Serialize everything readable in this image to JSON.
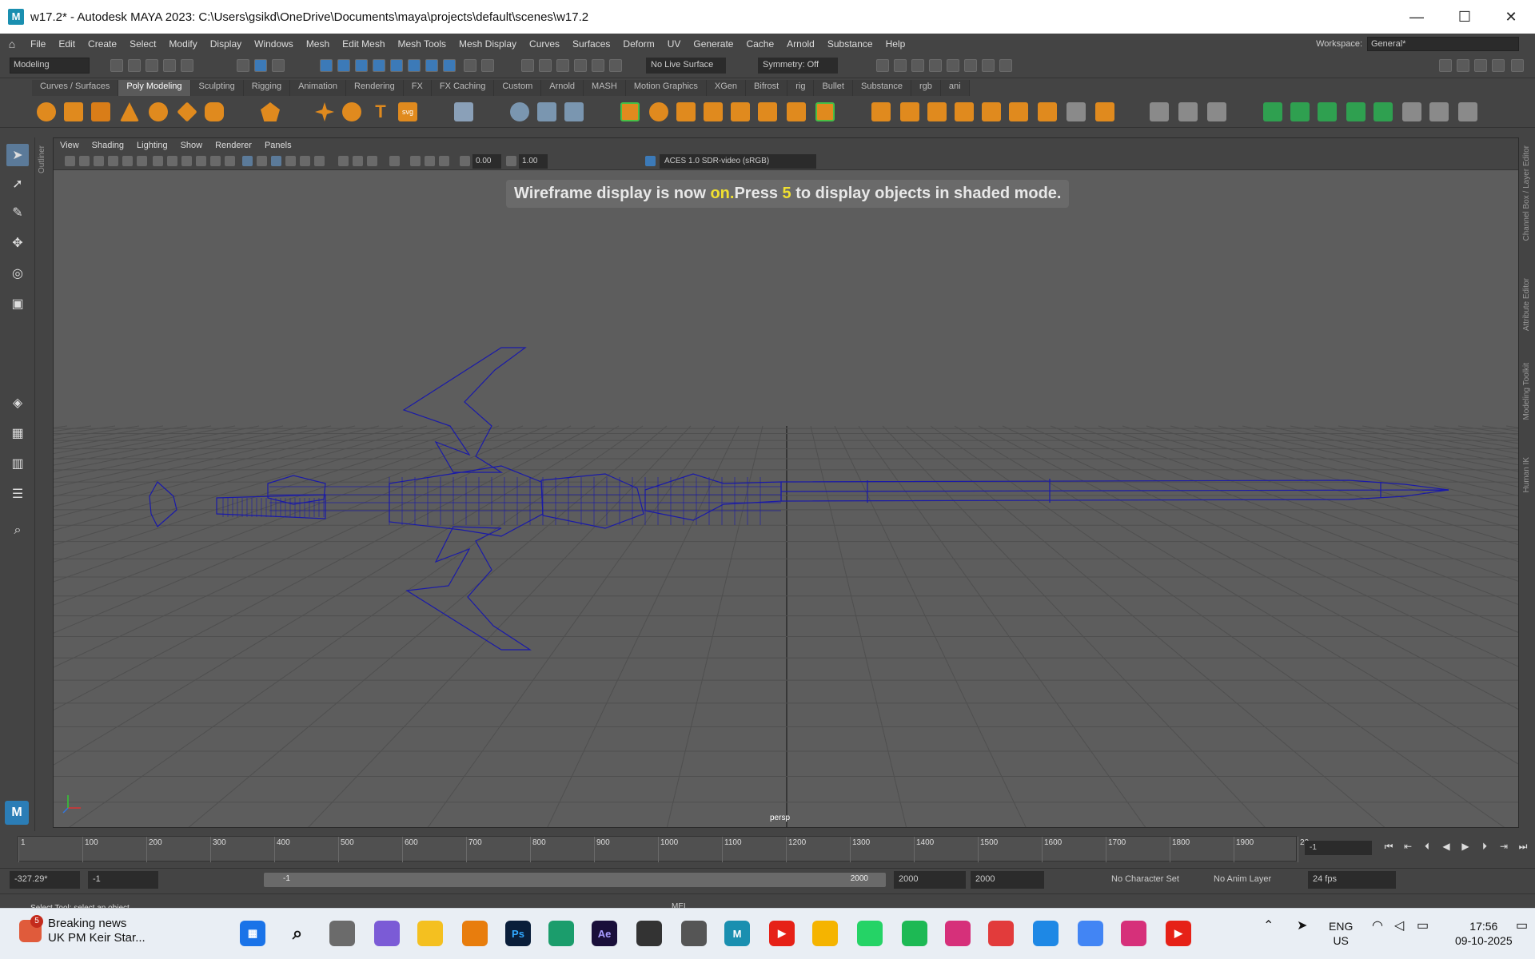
{
  "window": {
    "title": "w17.2* - Autodesk MAYA 2023: C:\\Users\\gsikd\\OneDrive\\Documents\\maya\\projects\\default\\scenes\\w17.2",
    "app_icon": "M",
    "minimize": "—",
    "maximize": "☐",
    "close": "✕"
  },
  "menu": [
    "File",
    "Edit",
    "Create",
    "Select",
    "Modify",
    "Display",
    "Windows",
    "Mesh",
    "Edit Mesh",
    "Mesh Tools",
    "Mesh Display",
    "Curves",
    "Surfaces",
    "Deform",
    "UV",
    "Generate",
    "Cache",
    "Arnold",
    "Substance",
    "Help"
  ],
  "workspace": {
    "label": "Workspace:",
    "value": "General*"
  },
  "statusline": {
    "mode": "Modeling",
    "live_surface": "No Live Surface",
    "symmetry": "Symmetry: Off"
  },
  "shelf_tabs": [
    "Curves / Surfaces",
    "Poly Modeling",
    "Sculpting",
    "Rigging",
    "Animation",
    "Rendering",
    "FX",
    "FX Caching",
    "Custom",
    "Arnold",
    "MASH",
    "Motion Graphics",
    "XGen",
    "Bifrost",
    "rig",
    "Bullet",
    "Substance",
    "rgb",
    "ani"
  ],
  "shelf_active": "Poly Modeling",
  "shelf_text_icons": {
    "text": "T",
    "svg": "svg"
  },
  "outliner_label": "Outliner",
  "viewport": {
    "menu": [
      "View",
      "Shading",
      "Lighting",
      "Show",
      "Renderer",
      "Panels"
    ],
    "exposure": "0.00",
    "gamma": "1.00",
    "color_space": "ACES 1.0 SDR-video (sRGB)",
    "hud_prefix": "Wireframe display is now ",
    "hud_on": "on.",
    "hud_mid": "Press ",
    "hud_key": "5",
    "hud_suffix": " to display objects in shaded mode.",
    "camera": "persp",
    "wire_color": "#1a1aa8"
  },
  "right_panel": [
    "Channel Box / Layer Editor",
    "Attribute Editor",
    "Modeling Toolkit",
    "Human IK"
  ],
  "timeline": {
    "ticks": [
      "1",
      "100",
      "200",
      "300",
      "400",
      "500",
      "600",
      "700",
      "800",
      "900",
      "1000",
      "1100",
      "1200",
      "1300",
      "1400",
      "1500",
      "1600",
      "1700",
      "1800",
      "1900",
      "20"
    ],
    "current_frame": "-1"
  },
  "range": {
    "coord": "-327.29*",
    "start": "-1",
    "range_start": "-1",
    "range_end": "2000",
    "end1": "2000",
    "end2": "2000",
    "character_set": "No Character Set",
    "anim_layer": "No Anim Layer",
    "fps": "24 fps"
  },
  "help_line": "Select Tool: select an object",
  "cmd_label": "MEL",
  "taskbar": {
    "news_badge": "5",
    "news_title": "Breaking news",
    "news_sub": "UK PM Keir Star...",
    "lang1": "ENG",
    "lang2": "US",
    "time": "17:56",
    "date": "09-10-2025",
    "app_labels": {
      "ps": "Ps",
      "ae": "Ae",
      "maya": "M"
    }
  }
}
